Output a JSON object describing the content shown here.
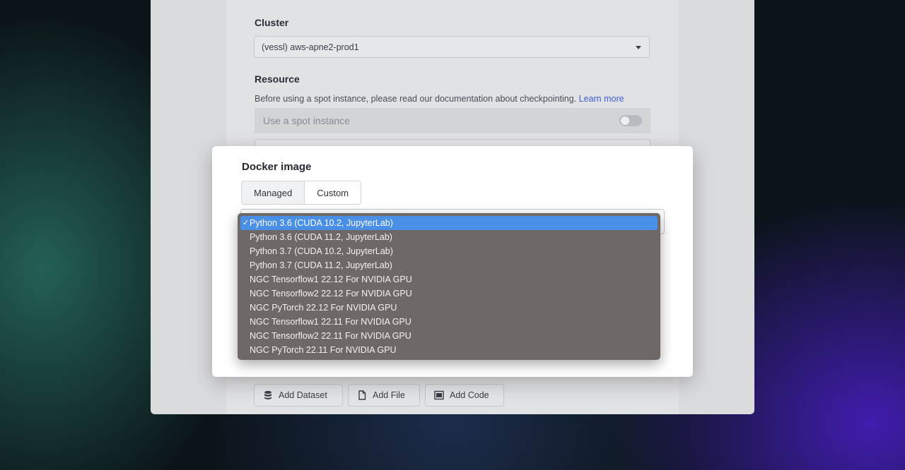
{
  "form": {
    "cluster_label": "Cluster",
    "cluster_value": "(vessl) aws-apne2-prod1",
    "resource_label": "Resource",
    "resource_note": "Before using a spot instance, please read our documentation about checkpointing.",
    "learn_more": "Learn more",
    "spot_label": "Use a spot instance",
    "spot_enabled": false
  },
  "bottom_buttons": {
    "add_dataset": "Add Dataset",
    "add_file": "Add File",
    "add_code": "Add Code"
  },
  "modal": {
    "title": "Docker image",
    "tabs": [
      {
        "label": "Managed",
        "active": true
      },
      {
        "label": "Custom",
        "active": false
      }
    ]
  },
  "dropdown": {
    "selected_index": 0,
    "options": [
      "Python 3.6 (CUDA 10.2, JupyterLab)",
      "Python 3.6 (CUDA 11.2, JupyterLab)",
      "Python 3.7 (CUDA 10.2, JupyterLab)",
      "Python 3.7 (CUDA 11.2, JupyterLab)",
      "NGC Tensorflow1 22.12 For NVIDIA GPU",
      "NGC Tensorflow2 22.12 For NVIDIA GPU",
      "NGC PyTorch 22.12 For NVIDIA GPU",
      "NGC Tensorflow1 22.11 For NVIDIA GPU",
      "NGC Tensorflow2 22.11 For NVIDIA GPU",
      "NGC PyTorch 22.11 For NVIDIA GPU"
    ]
  },
  "colors": {
    "selected_option": "#4a8fe6",
    "link": "#4058d8",
    "dropdown_bg": "#6e6966"
  }
}
